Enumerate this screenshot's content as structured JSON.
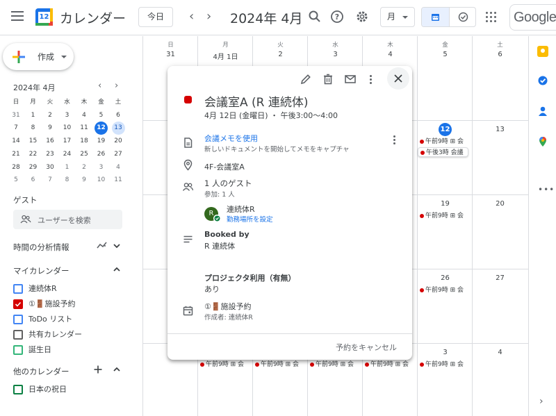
{
  "header": {
    "app_title": "カレンダー",
    "logo_day": "12",
    "today_label": "今日",
    "month_title": "2024年 4月",
    "view_label": "月",
    "google_label": "Google"
  },
  "sidebar": {
    "create_label": "作成",
    "mini_title": "2024年 4月",
    "mini_dow": [
      "日",
      "月",
      "火",
      "水",
      "木",
      "金",
      "土"
    ],
    "mini_weeks": [
      [
        "31",
        "1",
        "2",
        "3",
        "4",
        "5",
        "6"
      ],
      [
        "7",
        "8",
        "9",
        "10",
        "11",
        "12",
        "13"
      ],
      [
        "14",
        "15",
        "16",
        "17",
        "18",
        "19",
        "20"
      ],
      [
        "21",
        "22",
        "23",
        "24",
        "25",
        "26",
        "27"
      ],
      [
        "28",
        "29",
        "30",
        "1",
        "2",
        "3",
        "4"
      ],
      [
        "5",
        "6",
        "7",
        "8",
        "9",
        "10",
        "11"
      ]
    ],
    "guest_label": "ゲスト",
    "guest_search_placeholder": "ユーザーを検索",
    "time_insights_label": "時間の分析情報",
    "my_calendars_label": "マイカレンダー",
    "my_calendars": [
      {
        "label": "連続体R",
        "color": "#4285f4",
        "checked": false
      },
      {
        "label": "①🚪施設予約",
        "color": "#d50000",
        "checked": true
      },
      {
        "label": "ToDo リスト",
        "color": "#4285f4",
        "checked": false
      },
      {
        "label": "共有カレンダー",
        "color": "#616161",
        "checked": false
      },
      {
        "label": "誕生日",
        "color": "#33b679",
        "checked": false
      }
    ],
    "other_calendars_label": "他のカレンダー",
    "other_calendars": [
      {
        "label": "日本の祝日",
        "color": "#0b8043",
        "checked": false
      }
    ]
  },
  "grid": {
    "dow": [
      "日",
      "月",
      "火",
      "水",
      "木",
      "金",
      "土"
    ],
    "first_row_dates": [
      "31",
      "4月 1日",
      "2",
      "3",
      "4",
      "5",
      "6"
    ],
    "row2_dates": {
      "fri": "12",
      "sat": "13"
    },
    "row3_dates": {
      "fri": "19",
      "sat": "20"
    },
    "row4_dates": {
      "fri": "26",
      "sat": "27"
    },
    "row5_dates": {
      "fri": "3",
      "sat": "4"
    },
    "events": {
      "r2_fri_a": "午前9時 ⊞ 会",
      "r2_fri_b": "午後3時 会議",
      "r3_fri": "午前9時 ⊞ 会",
      "r4_fri": "午前9時 ⊞ 会",
      "r5_mon": "午前9時 ⊞ 会",
      "r5_tue": "午前9時 ⊞ 会",
      "r5_wed": "午前9時 ⊞ 会",
      "r5_thu": "午前9時 ⊞ 会",
      "r5_fri": "午前9時 ⊞ 会"
    }
  },
  "popup": {
    "title": "会議室A (R 連続体)",
    "time": "4月 12日 (金曜日) ・ 午後3:00～4:00",
    "notes_link": "会議メモを使用",
    "notes_sub": "新しいドキュメントを開始してメモをキャプチャ",
    "location": "4F-会議室A",
    "guests_count": "1 人のゲスト",
    "guests_sub": "参加: 1 人",
    "guest_name": "連続体R",
    "guest_initial": "R",
    "guest_link": "勤務場所を設定",
    "booked_by_label": "Booked by",
    "booked_by_value": "R 連続体",
    "projector_label": "プロジェクタ利用（有無）",
    "projector_value": "あり",
    "calendar_name": "①🚪施設予約",
    "calendar_creator": "作成者: 連続体R",
    "cancel_label": "予約をキャンセル",
    "accent": "#d50000"
  }
}
